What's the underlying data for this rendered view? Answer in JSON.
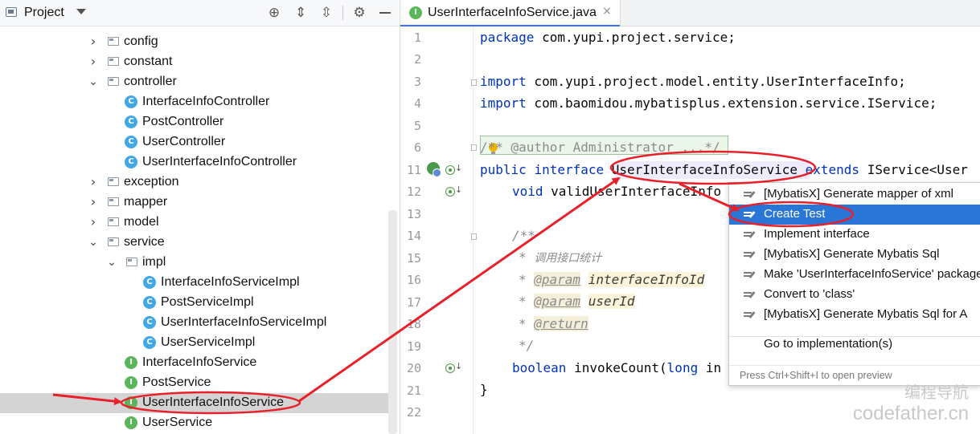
{
  "project_panel": {
    "title": "Project",
    "tree": [
      {
        "label": "config",
        "kind": "folder",
        "expanded": false,
        "depth": 1
      },
      {
        "label": "constant",
        "kind": "folder",
        "expanded": false,
        "depth": 1
      },
      {
        "label": "controller",
        "kind": "folder",
        "expanded": true,
        "depth": 1
      },
      {
        "label": "InterfaceInfoController",
        "kind": "class",
        "depth": 2
      },
      {
        "label": "PostController",
        "kind": "class",
        "depth": 2
      },
      {
        "label": "UserController",
        "kind": "class",
        "depth": 2
      },
      {
        "label": "UserInterfaceInfoController",
        "kind": "class",
        "depth": 2
      },
      {
        "label": "exception",
        "kind": "folder",
        "expanded": false,
        "depth": 1
      },
      {
        "label": "mapper",
        "kind": "folder",
        "expanded": false,
        "depth": 1
      },
      {
        "label": "model",
        "kind": "folder",
        "expanded": false,
        "depth": 1
      },
      {
        "label": "service",
        "kind": "folder",
        "expanded": true,
        "depth": 1
      },
      {
        "label": "impl",
        "kind": "folder",
        "expanded": true,
        "depth": 2
      },
      {
        "label": "InterfaceInfoServiceImpl",
        "kind": "class",
        "depth": 3
      },
      {
        "label": "PostServiceImpl",
        "kind": "class",
        "depth": 3
      },
      {
        "label": "UserInterfaceInfoServiceImpl",
        "kind": "class",
        "depth": 3
      },
      {
        "label": "UserServiceImpl",
        "kind": "class",
        "depth": 3
      },
      {
        "label": "InterfaceInfoService",
        "kind": "interface",
        "depth": 2
      },
      {
        "label": "PostService",
        "kind": "interface",
        "depth": 2
      },
      {
        "label": "UserInterfaceInfoService",
        "kind": "interface",
        "depth": 2,
        "selected": true
      },
      {
        "label": "UserService",
        "kind": "interface",
        "depth": 2
      }
    ]
  },
  "editor": {
    "tab": {
      "label": "UserInterfaceInfoService.java",
      "close": "×",
      "icon_letter": "I"
    },
    "lines": [
      {
        "num": "1"
      },
      {
        "num": "2"
      },
      {
        "num": "3"
      },
      {
        "num": "4"
      },
      {
        "num": "5"
      },
      {
        "num": "6"
      },
      {
        "num": "11"
      },
      {
        "num": "12"
      },
      {
        "num": "13"
      },
      {
        "num": "14"
      },
      {
        "num": "15"
      },
      {
        "num": "16"
      },
      {
        "num": "17"
      },
      {
        "num": "18"
      },
      {
        "num": "19"
      },
      {
        "num": "20"
      },
      {
        "num": "21"
      },
      {
        "num": "22"
      }
    ],
    "code": {
      "l1_kw": "package",
      "l1_rest": " com.yupi.project.service;",
      "l3_kw": "import",
      "l3_rest": " com.yupi.project.model.entity.UserInterfaceInfo;",
      "l4_kw": "import",
      "l4_rest": " com.baomidou.mybatisplus.extension.service.IService;",
      "l6_comment": "/** @author Administrator ...*/",
      "l11_kw1": "public",
      "l11_kw2": "interface",
      "l11_name": "UserInterfaceInfoService",
      "l11_kw3": "extends",
      "l11_rest": "IService<User",
      "l12_kw": "void",
      "l12_rest": " validUserInterfaceInfo",
      "l14_doc": "/**",
      "l15_star": "* ",
      "l15_text": "调用接口统计",
      "l16_star": "* ",
      "l16_tag": "@param",
      "l16_param": "interfaceInfoId",
      "l17_star": "* ",
      "l17_tag": "@param",
      "l17_param": "userId",
      "l18_star": "* ",
      "l18_tag": "@return",
      "l19_doc": "*/",
      "l20_kw1": "boolean",
      "l20_name": " invokeCount(",
      "l20_kw2": "long",
      "l20_rest": " in",
      "l21": "}"
    }
  },
  "context_menu": {
    "items": [
      {
        "label": "[MybatisX] Generate mapper of xml"
      },
      {
        "label": "Create Test",
        "selected": true
      },
      {
        "label": "Implement interface"
      },
      {
        "label": "[MybatisX] Generate Mybatis Sql"
      },
      {
        "label": "Make 'UserInterfaceInfoService' package"
      },
      {
        "label": "Convert to 'class'"
      },
      {
        "label": "[MybatisX] Generate Mybatis Sql for A"
      },
      {
        "label": "Go to implementation(s)"
      }
    ],
    "footer": "Press Ctrl+Shift+I to open preview"
  },
  "watermark": {
    "cn": "编程导航",
    "en": "codefather.cn"
  },
  "colors": {
    "annotation_red": "#e8202a",
    "selection_blue": "#2a76d6",
    "keyword": "#0033b3"
  }
}
